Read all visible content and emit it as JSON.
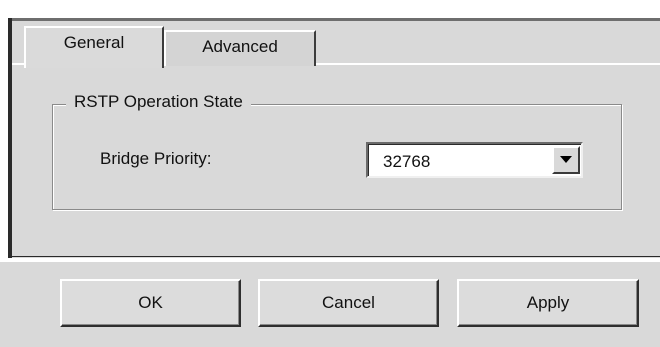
{
  "tabs": [
    {
      "label": "General",
      "selected": true
    },
    {
      "label": "Advanced",
      "selected": false
    }
  ],
  "group": {
    "title": "RSTP Operation State"
  },
  "bridge_priority": {
    "label": "Bridge Priority:",
    "value": "32768",
    "arrow_icon": "dropdown-arrow-icon"
  },
  "buttons": {
    "ok_label": "OK",
    "cancel_label": "Cancel",
    "apply_label": "Apply"
  },
  "colors": {
    "panel_background": "#d9d9d9",
    "field_background": "#ffffff",
    "text": "#111111"
  }
}
